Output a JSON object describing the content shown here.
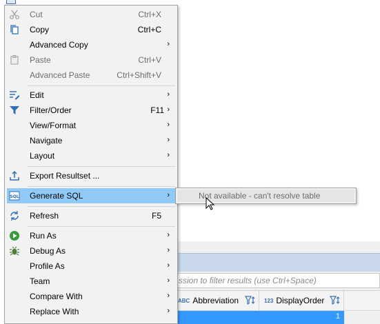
{
  "menu": {
    "items": [
      {
        "label": "Cut",
        "shortcut": "Ctrl+X",
        "icon": "scissors-icon",
        "disabled": true
      },
      {
        "label": "Copy",
        "shortcut": "Ctrl+C",
        "icon": "copy-icon"
      },
      {
        "label": "Advanced Copy",
        "submenu": true
      },
      {
        "label": "Paste",
        "shortcut": "Ctrl+V",
        "icon": "clipboard-icon",
        "disabled": true
      },
      {
        "label": "Advanced Paste",
        "shortcut": "Ctrl+Shift+V",
        "disabled": true
      },
      {
        "label": "Edit",
        "submenu": true,
        "icon": "edit-icon"
      },
      {
        "label": "Filter/Order",
        "shortcut": "F11",
        "submenu": true,
        "icon": "filter-icon"
      },
      {
        "label": "View/Format",
        "submenu": true
      },
      {
        "label": "Navigate",
        "submenu": true
      },
      {
        "label": "Layout",
        "submenu": true
      },
      {
        "label": "Export Resultset ...",
        "icon": "export-icon"
      },
      {
        "label": "Generate SQL",
        "submenu": true,
        "icon": "sql-icon",
        "highlighted": true
      },
      {
        "label": "Refresh",
        "shortcut": "F5",
        "icon": "refresh-icon"
      },
      {
        "label": "Run As",
        "submenu": true,
        "icon": "run-icon"
      },
      {
        "label": "Debug As",
        "submenu": true,
        "icon": "bug-icon"
      },
      {
        "label": "Profile As",
        "submenu": true
      },
      {
        "label": "Team",
        "submenu": true
      },
      {
        "label": "Compare With",
        "submenu": true
      },
      {
        "label": "Replace With",
        "submenu": true
      }
    ],
    "arrow": "›"
  },
  "submenu": {
    "label": "Not available - can't resolve table"
  },
  "background": {
    "filter_placeholder": "ssion to filter results (use Ctrl+Space)",
    "columns": [
      {
        "type": "ABC",
        "name": "Abbreviation"
      },
      {
        "type": "123",
        "name": "DisplayOrder"
      }
    ],
    "row_value": "1"
  },
  "colors": {
    "highlight": "#91c9f7",
    "selection": "#3399ff",
    "menu_bg": "#f2f2f2"
  }
}
